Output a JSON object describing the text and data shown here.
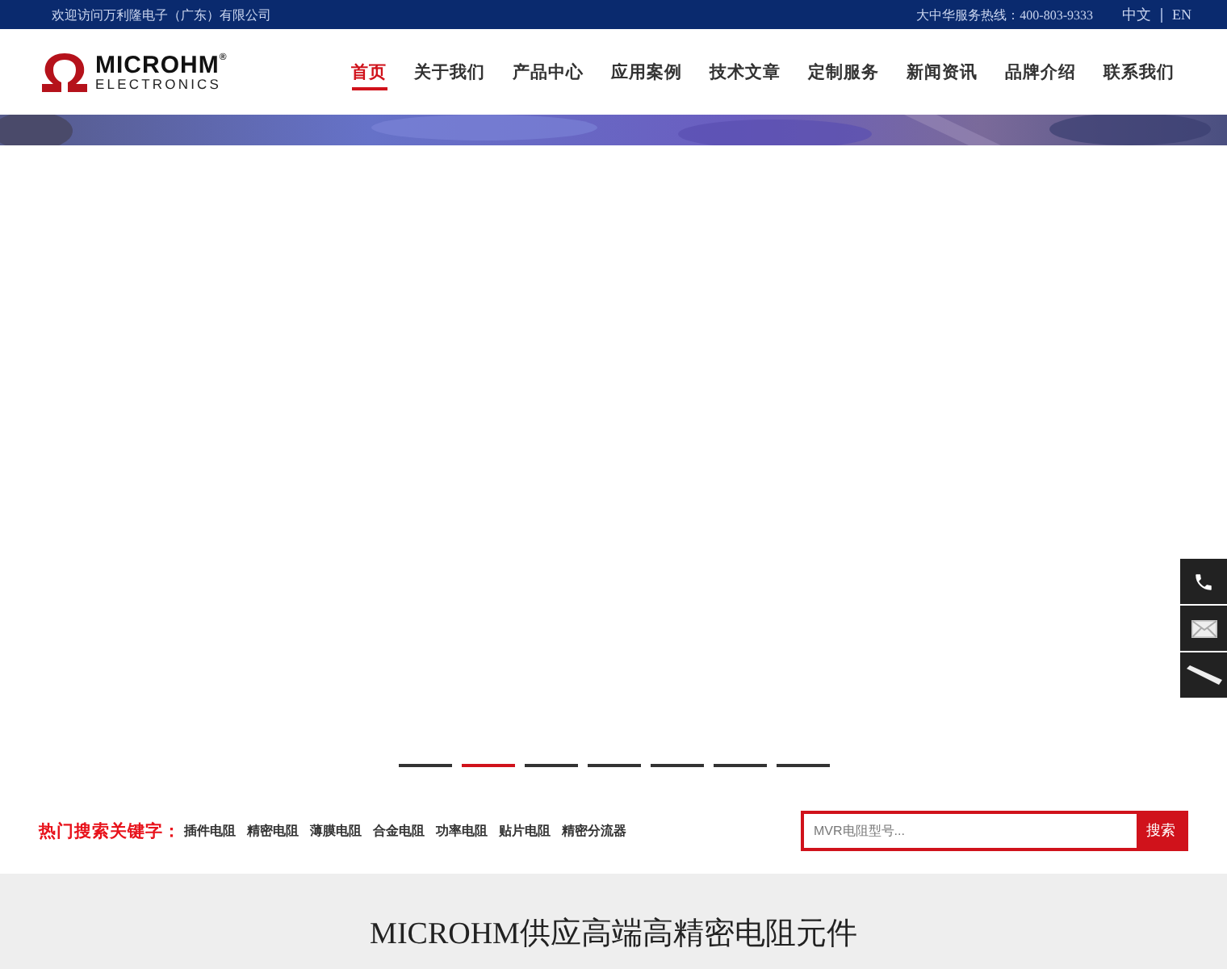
{
  "top_bar": {
    "welcome": "欢迎访问万利隆电子（广东）有限公司",
    "hotline": "大中华服务热线：400-803-9333",
    "languages": [
      {
        "label": "中文",
        "selected": false
      },
      {
        "label": "EN",
        "selected": false
      }
    ]
  },
  "logo": {
    "name": "MICROHM",
    "mark": "®",
    "sub": "ELECTRONICS"
  },
  "nav": [
    {
      "label": "首页",
      "selected": true
    },
    {
      "label": "关于我们",
      "selected": false
    },
    {
      "label": "产品中心",
      "selected": false
    },
    {
      "label": "应用案例",
      "selected": false
    },
    {
      "label": "技术文章",
      "selected": false
    },
    {
      "label": "定制服务",
      "selected": false
    },
    {
      "label": "新闻资讯",
      "selected": false
    },
    {
      "label": "品牌介绍",
      "selected": false
    },
    {
      "label": "联系我们",
      "selected": false
    }
  ],
  "slider_dots": [
    {
      "selected": false
    },
    {
      "selected": true
    },
    {
      "selected": false
    },
    {
      "selected": false
    },
    {
      "selected": false
    },
    {
      "selected": false
    },
    {
      "selected": false
    }
  ],
  "hot_search": {
    "label": "热门搜索关键字：",
    "keywords": [
      "插件电阻",
      "精密电阻",
      "薄膜电阻",
      "合金电阻",
      "功率电阻",
      "贴片电阻",
      "精密分流器"
    ]
  },
  "search": {
    "placeholder": "MVR电阻型号...",
    "button": "搜索"
  },
  "side_tools": [
    {
      "kind": "phone"
    },
    {
      "kind": "mail"
    },
    {
      "kind": "strip"
    }
  ],
  "section": {
    "title": "MICROHM供应高端高精密电阻元件"
  }
}
